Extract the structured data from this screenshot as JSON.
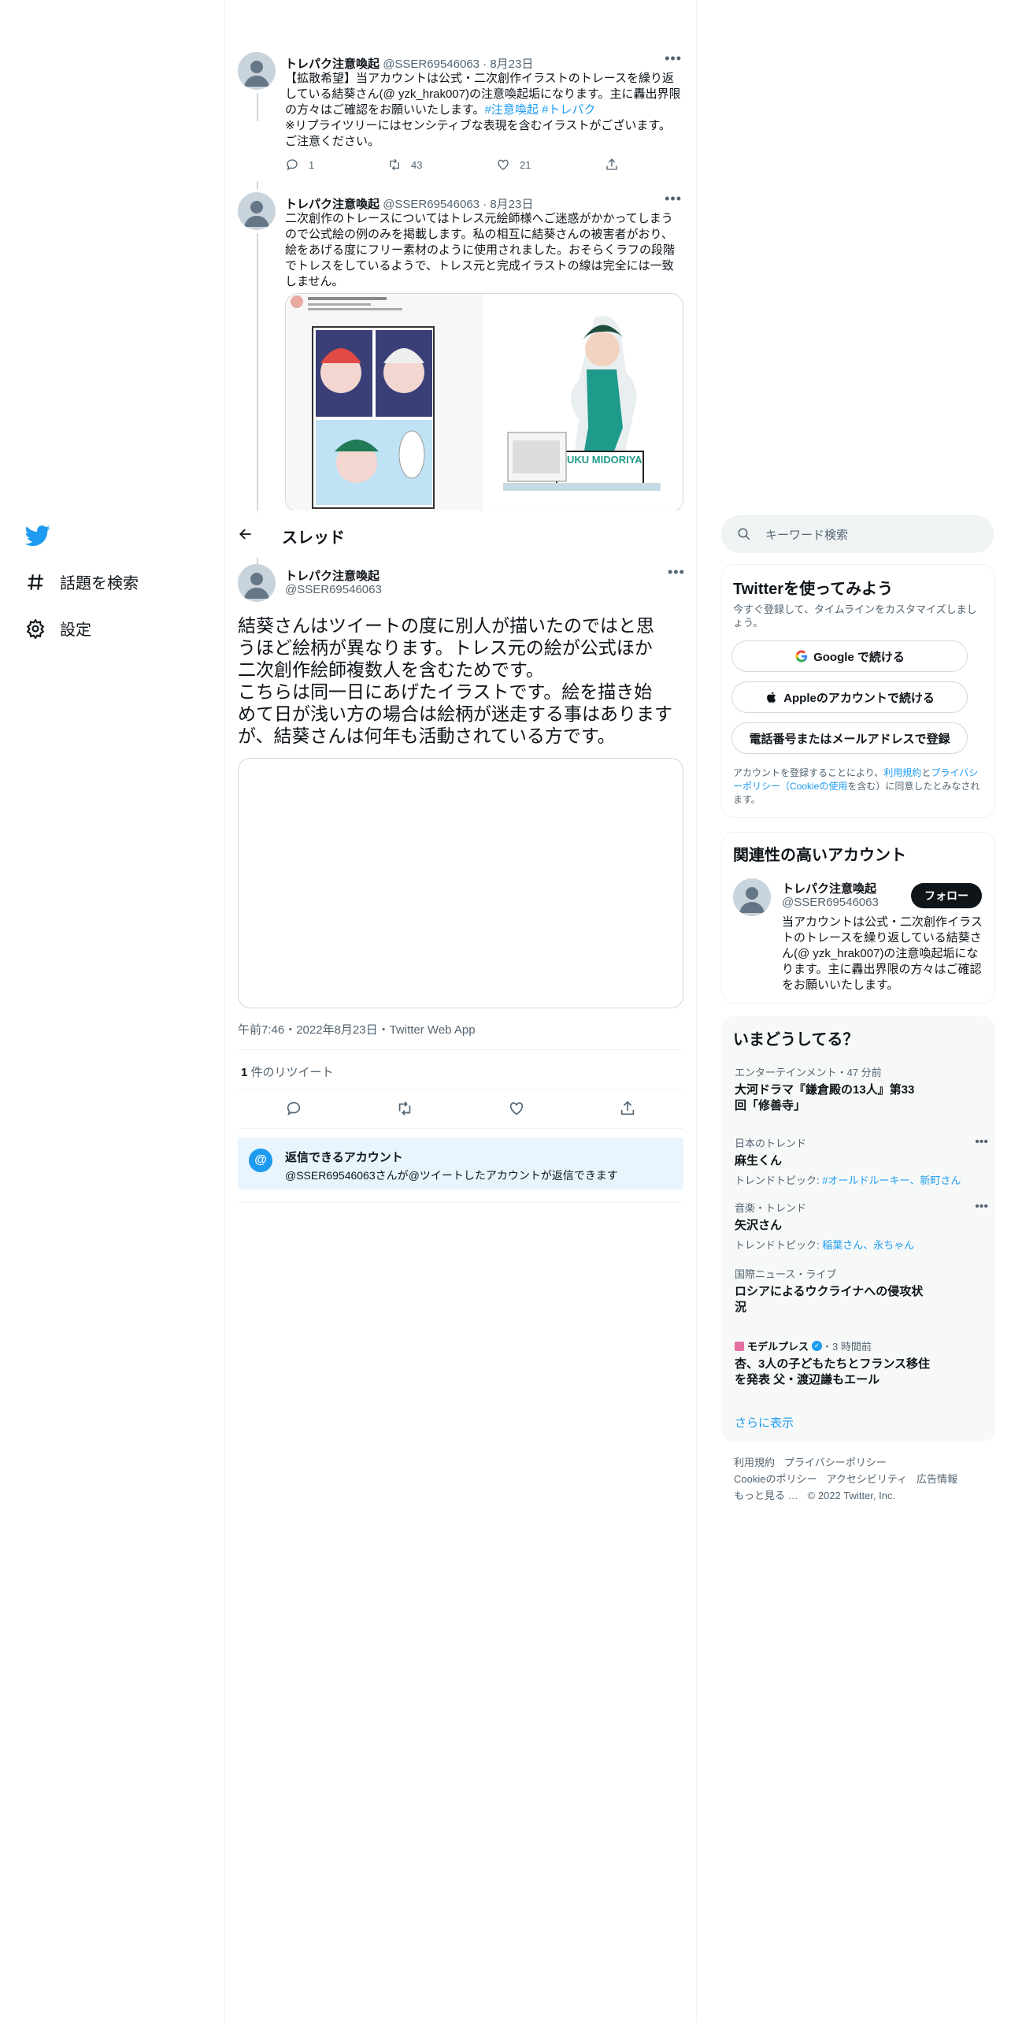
{
  "nav": {
    "items": [
      {
        "label": "話題を検索",
        "icon": "hash-icon"
      },
      {
        "label": "設定",
        "icon": "gear-icon"
      }
    ]
  },
  "tweets": [
    {
      "name": "トレパク注意喚起",
      "handle": "@SSER69546063",
      "date": "8月23日",
      "lines": [
        "【拡散希望】当アカウントは公式・二次創作イラストのトレースを繰り返",
        "している結葵さん(@ yzk_hrak007)の注意喚起垢になります。主に轟出界限",
        "の方々はご確認をお願いいたします。",
        "※リプライツリーにはセンシティブな表現を含むイラストがございます。",
        "ご注意ください。"
      ],
      "hashtags": "#注意喚起 #トレパク",
      "replies": "1",
      "retweets": "43",
      "likes": "21"
    },
    {
      "name": "トレパク注意喚起",
      "handle": "@SSER69546063",
      "date": "8月23日",
      "lines": [
        "二次創作のトレースについてはトレス元絵師様へご迷惑がかかってしまう",
        "ので公式絵の例のみを掲載します。私の相互に結葵さんの被害者がおり、",
        "絵をあげる度にフリー素材のように使用されました。おそらくラフの段階",
        "でトレスをしているようで、トレス元と完成イラストの線は完全には一致",
        "しません。"
      ],
      "media_caption": "IZUKU MIDORIYA"
    }
  ],
  "header": {
    "title": "スレッド"
  },
  "main_tweet": {
    "name": "トレパク注意喚起",
    "handle": "@SSER69546063",
    "lines": [
      "結葵さんはツイートの度に別人が描いたのではと思",
      "うほど絵柄が異なります。トレス元の絵が公式ほか",
      "二次創作絵師複数人を含むためです。",
      "こちらは同一日にあげたイラストです。絵を描き始",
      "めて日が浅い方の場合は絵柄が迷走する事はあります",
      "が、結葵さんは何年も活動されている方です。"
    ],
    "timestamp": "午前7:46・2022年8月23日・Twitter Web App",
    "retweet_count": "1",
    "retweet_label": "件のリツイート"
  },
  "reply_box": {
    "title": "返信できるアカウント",
    "desc": "@SSER69546063さんが@ツイートしたアカウントが返信できます"
  },
  "search": {
    "placeholder": "キーワード検索"
  },
  "signup": {
    "title": "Twitterを使ってみよう",
    "desc": "今すぐ登録して、タイムラインをカスタマイズしましょう。",
    "google": "Google で続ける",
    "apple": "Appleのアカウントで続ける",
    "phone": "電話番号またはメールアドレスで登録",
    "legal_1": "アカウントを登録することにより、",
    "legal_terms": "利用規約",
    "legal_2": "と",
    "legal_privacy": "プライバシーポリシー（Cookieの使用",
    "legal_3": "を含む）に同意したとみなされます。"
  },
  "related": {
    "title": "関連性の高いアカウント",
    "name": "トレパク注意喚起",
    "handle": "@SSER69546063",
    "follow": "フォロー",
    "bio": "当アカウントは公式・二次創作イラストのトレースを繰り返している結葵さん(@ yzk_hrak007)の注意喚起垢になります。主に轟出界限の方々はご確認をお願いいたします。"
  },
  "trends": {
    "title": "いまどうしてる？",
    "items": [
      {
        "meta": "エンターテインメント・47 分前",
        "name": "大河ドラマ『鎌倉殿の13人』第33回「修善寺」",
        "sub": ""
      },
      {
        "meta": "日本のトレンド",
        "name": "麻生くん",
        "sub_label": "トレンドトピック: ",
        "sub": "#オールドルーキー、新町さん"
      },
      {
        "meta": "音楽・トレンド",
        "name": "矢沢さん",
        "sub_label": "トレンドトピック: ",
        "sub": "稲葉さん、永ちゃん"
      },
      {
        "meta": "国際ニュース・ライブ",
        "name": "ロシアによるウクライナへの侵攻状況",
        "sub": ""
      },
      {
        "meta_source": "モデルプレス",
        "meta": "・3 時間前",
        "name": "杏、3人の子どもたちとフランス移住を発表 父・渡辺謙もエール",
        "sub": ""
      }
    ],
    "more": "さらに表示"
  },
  "footer": {
    "links": [
      "利用規約",
      "プライバシーポリシー",
      "Cookieのポリシー",
      "アクセシビリティ",
      "広告情報",
      "もっと見る …"
    ],
    "copyright": "© 2022 Twitter, Inc."
  },
  "colors": {
    "accent": "#1d9bf0",
    "text": "#0f1419",
    "secondary": "#536471"
  }
}
